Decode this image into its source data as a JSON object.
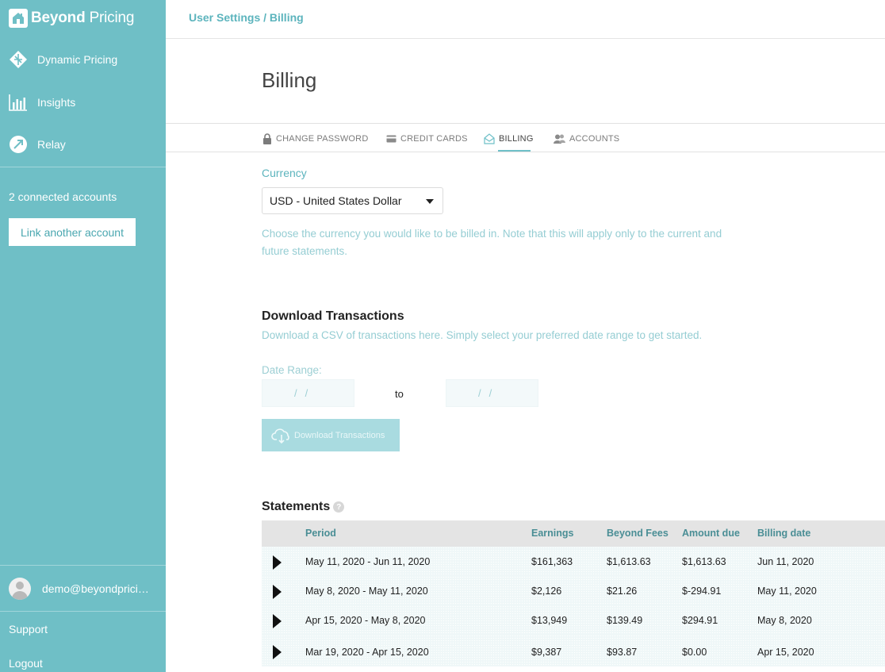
{
  "app": {
    "brand_bold": "Beyond",
    "brand_light": " Pricing"
  },
  "sidebar": {
    "items": [
      {
        "label": "Dynamic Pricing",
        "icon": "dynamic-pricing-icon"
      },
      {
        "label": "Insights",
        "icon": "bar-chart-icon"
      },
      {
        "label": "Relay",
        "icon": "relay-icon"
      }
    ],
    "connected_accounts": "2 connected accounts",
    "link_account_label": "Link another account",
    "user_email": "demo@beyondpricing.com",
    "support_label": "Support",
    "logout_label": "Logout"
  },
  "header": {
    "breadcrumb": "User Settings / Billing",
    "page_title": "Billing"
  },
  "tabs": [
    {
      "label": "CHANGE PASSWORD",
      "icon": "lock-icon"
    },
    {
      "label": "CREDIT CARDS",
      "icon": "credit-card-icon"
    },
    {
      "label": "BILLING",
      "icon": "billing-icon",
      "active": true
    },
    {
      "label": "ACCOUNTS",
      "icon": "accounts-icon"
    }
  ],
  "currency": {
    "label": "Currency",
    "selected": "USD - United States Dollar",
    "help_line1": "Choose the currency you would like to be billed in. Note that this will apply only to the current and",
    "help_line2": "future statements."
  },
  "download": {
    "title": "Download Transactions",
    "description": "Download a CSV of transactions here. Simply select your preferred date range to get started.",
    "date_range_label": "Date Range:",
    "date_placeholder": "//",
    "to_label": "to",
    "button_label": "Download Transactions"
  },
  "statements": {
    "title": "Statements",
    "help": "?",
    "columns": [
      "Period",
      "Earnings",
      "Beyond Fees",
      "Amount due",
      "Billing date"
    ],
    "rows": [
      {
        "period": "May 11, 2020 - Jun 11, 2020",
        "earnings": "$161,363",
        "fees": "$1,613.63",
        "due": "$1,613.63",
        "date": "Jun 11, 2020"
      },
      {
        "period": "May 8, 2020 - May 11, 2020",
        "earnings": "$2,126",
        "fees": "$21.26",
        "due": "$-294.91",
        "date": "May 11, 2020"
      },
      {
        "period": "Apr 15, 2020 - May 8, 2020",
        "earnings": "$13,949",
        "fees": "$139.49",
        "due": "$294.91",
        "date": "May 8, 2020"
      },
      {
        "period": "Mar 19, 2020 - Apr 15, 2020",
        "earnings": "$9,387",
        "fees": "$93.87",
        "due": "$0.00",
        "date": "Apr 15, 2020"
      }
    ]
  },
  "colors": {
    "sidebar": "#6fbfc6",
    "accent": "#5cb4bd",
    "button_disabled": "#a9dbe0"
  }
}
